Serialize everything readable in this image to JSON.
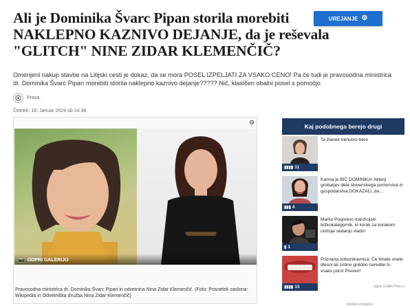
{
  "article": {
    "headline": "Ali je Dominika Švarc Pipan storila morebiti NAKLEPNO KAZNIVO DEJANJE, da je reševala \"GLITCH\" NINE ZIDAR KLEMENČIČ?",
    "lead": "Omenjeni nakup stavbe na Litijski cesti je dokaz, da se mora POSEL IZPELJATI ZA VSAKO CENO! Pa če tudi je pravosodna ministrica dr. Dominika Švarc Pipan morebiti storila naklepno kaznivo dejanje????? Nič, klasičen obalni posel s pomočjo",
    "author": "Prava .",
    "date": "Četrtek, 18. Januar 2024 ob 14:36",
    "photo_credit": "ODPRI GALERIJO",
    "caption": "Pravosodna ministrica dr. Dominika Švarc Pipan in odvetnica Nina Zidar Klemenčič. (Foto: Posnetek zaslona-Wikipedia in Odvetniška družba Nina Zidar Klemenčič)"
  },
  "toolbar": {
    "edit_label": "UREJANJE"
  },
  "sidebar": {
    "title": "Kaj podobnega berejo drugi",
    "items": [
      {
        "title": "Ta žlanek trenutno bere",
        "count": "11"
      },
      {
        "title": "Karma je BIČ DOMINIKA! Akterji grobarjev dela slovenskega pomorstva in gospodarstva DOKAZALI, da ...",
        "count": "4"
      },
      {
        "title": "Marko Pogorevc-tranzicijski težkokategornik, ki korak za korakom uničuje sedanjo vlado!",
        "count": "1"
      },
      {
        "title": "Priznana zobozdravnica: Če limate vnete dlesni ali zobno gnilobo naredite to vsako jutro! Preveri!",
        "count": "15"
      }
    ],
    "sponsor_note": "oglas GoldenTree.si",
    "footer_note": "storitev omogoča"
  },
  "colors": {
    "accent": "#1e6fd0",
    "sidebar_navy": "#1f3a63"
  }
}
